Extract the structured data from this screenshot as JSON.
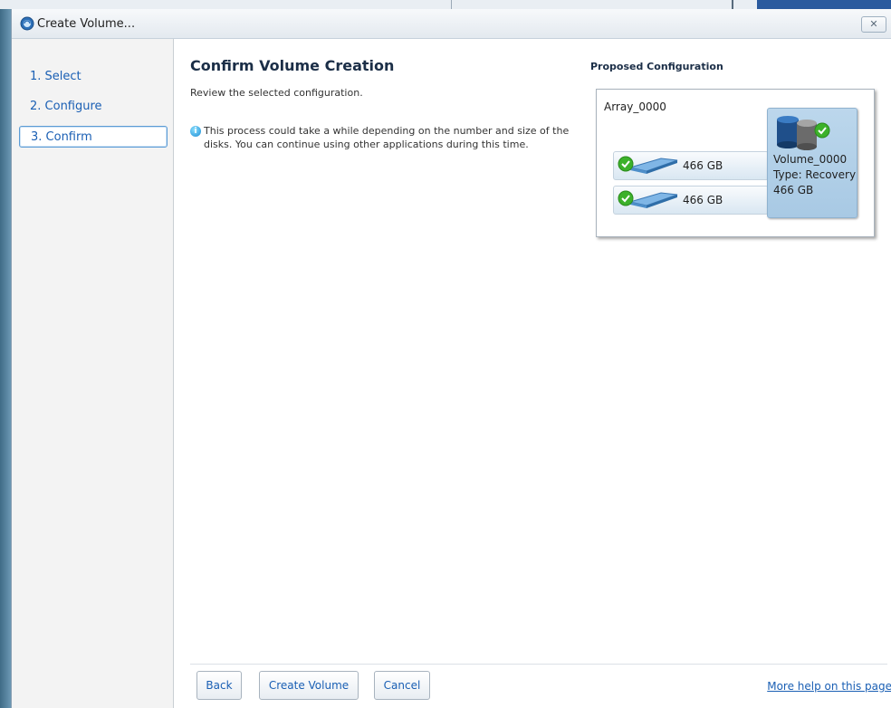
{
  "window": {
    "title": "Create Volume...",
    "close_label": "✕"
  },
  "sidebar": {
    "steps": [
      {
        "label": "1. Select"
      },
      {
        "label": "2. Configure"
      },
      {
        "label": "3. Confirm"
      }
    ],
    "active_step": "3. Confirm"
  },
  "main": {
    "heading": "Confirm Volume Creation",
    "subtext": "Review the selected configuration.",
    "info_text": "This process could take a while depending on the number and size of the disks. You can continue using other applications during this time."
  },
  "config": {
    "title": "Proposed Configuration",
    "array_name": "Array_0000",
    "disks": [
      {
        "size": "466 GB"
      },
      {
        "size": "466 GB"
      }
    ],
    "volume": {
      "name": "Volume_0000",
      "type": "Type: Recovery",
      "size": "466 GB"
    }
  },
  "footer": {
    "back_label": "Back",
    "create_label": "Create Volume",
    "cancel_label": "Cancel",
    "help_link": "More help on this page"
  },
  "colors": {
    "link": "#1a5fb4",
    "heading": "#1b2e47",
    "volume_card": "#bcd7ec",
    "check": "#3cb12a"
  }
}
